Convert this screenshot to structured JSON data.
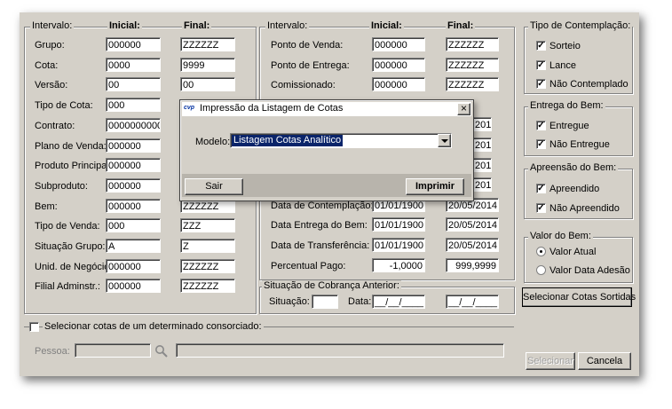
{
  "left_group": {
    "title": "Intervalo:",
    "col_initial": "Inicial:",
    "col_final": "Final:",
    "rows": [
      {
        "label": "Grupo:",
        "initial": "000000",
        "final": "ZZZZZZ"
      },
      {
        "label": "Cota:",
        "initial": "0000",
        "final": "9999"
      },
      {
        "label": "Versão:",
        "initial": "00",
        "final": "00"
      },
      {
        "label": "Tipo de Cota:",
        "initial": "000",
        "final": ""
      },
      {
        "label": "Contrato:",
        "initial": "0000000000",
        "final": ""
      },
      {
        "label": "Plano de Venda:",
        "initial": "000000",
        "final": ""
      },
      {
        "label": "Produto Principal:",
        "initial": "000000",
        "final": ""
      },
      {
        "label": "Subproduto:",
        "initial": "000000",
        "final": ""
      },
      {
        "label": "Bem:",
        "initial": "000000",
        "final": "ZZZZZZ"
      },
      {
        "label": "Tipo de Venda:",
        "initial": "000",
        "final": "ZZZ"
      },
      {
        "label": "Situação Grupo:",
        "initial": "A",
        "final": "Z"
      },
      {
        "label": "Unid. de Negócio:",
        "initial": "000000",
        "final": "ZZZZZZ"
      },
      {
        "label": "Filial Adminstr.:",
        "initial": "000000",
        "final": "ZZZZZZ"
      }
    ]
  },
  "mid_group": {
    "title": "Intervalo:",
    "col_initial": "Inicial:",
    "col_final": "Final:",
    "rows": [
      {
        "label": "Ponto de Venda:",
        "initial": "000000",
        "final": "ZZZZZZ"
      },
      {
        "label": "Ponto de Entrega:",
        "initial": "000000",
        "final": "ZZZZZZ"
      },
      {
        "label": "Comissionado:",
        "initial": "000000",
        "final": "ZZZZZZ"
      },
      {
        "label": "",
        "initial": "",
        "final": ""
      },
      {
        "label": "",
        "initial": "",
        "final": "2014"
      },
      {
        "label": "",
        "initial": "",
        "final": "2014"
      },
      {
        "label": "",
        "initial": "",
        "final": "2014"
      },
      {
        "label": "",
        "initial": "",
        "final": "2014"
      },
      {
        "label": "Data de Contemplação:",
        "initial": "01/01/1900",
        "final": "20/05/2014"
      },
      {
        "label": "Data Entrega do Bem:",
        "initial": "01/01/1900",
        "final": "20/05/2014"
      },
      {
        "label": "Data de Transferência:",
        "initial": "01/01/1900",
        "final": "20/05/2014"
      },
      {
        "label": "Percentual Pago:",
        "initial": "-1,0000",
        "final": "999,9999"
      }
    ]
  },
  "situacao": {
    "title": "Situação de Cobrança Anterior:",
    "situacao_label": "Situação:",
    "situacao_value": "",
    "data_label": "Data:",
    "data_value": "__/__/____",
    "data_final": "__/__/____"
  },
  "contemplacao": {
    "title": "Tipo  de Contemplação:",
    "items": [
      {
        "label": "Sorteio",
        "checked": true
      },
      {
        "label": "Lance",
        "checked": true
      },
      {
        "label": "Não Contemplado",
        "checked": true
      }
    ]
  },
  "entrega": {
    "title": "Entrega do Bem:",
    "items": [
      {
        "label": "Entregue",
        "checked": true
      },
      {
        "label": "Não Entregue",
        "checked": true
      }
    ]
  },
  "apreensao": {
    "title": "Apreensão do Bem:",
    "items": [
      {
        "label": "Apreendido",
        "checked": true
      },
      {
        "label": "Não Apreendido",
        "checked": true
      }
    ]
  },
  "valor": {
    "title": "Valor do Bem:",
    "items": [
      {
        "label": "Valor Atual",
        "selected": true
      },
      {
        "label": "Valor Data Adesão",
        "selected": false
      }
    ]
  },
  "buttons": {
    "select_sorted": "Selecionar Cotas Sortidas",
    "select": "Selecionar",
    "cancel": "Cancela"
  },
  "consorciado": {
    "checkbox_label": "Selecionar cotas de um determinado consorciado:",
    "pessoa_label": "Pessoa:",
    "pessoa_value": "",
    "name_value": ""
  },
  "dialog": {
    "icon_text": "cvp",
    "title": "Impressão da Listagem de Cotas",
    "modelo_label": "Modelo:",
    "modelo_value": "Listagem Cotas Analítico",
    "sair": "Sair",
    "imprimir": "Imprimir",
    "close_glyph": "×"
  }
}
